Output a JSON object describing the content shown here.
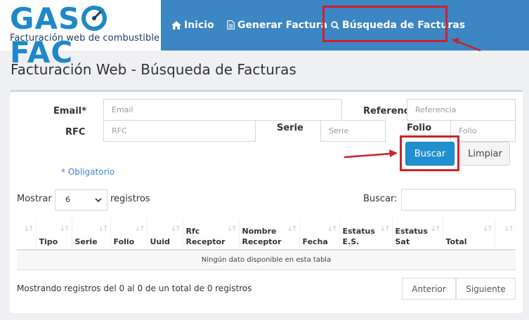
{
  "brand": {
    "logo_part1": "GAS",
    "logo_part2": "FAC",
    "tagline": "Facturación web de combustible"
  },
  "nav": {
    "items": [
      {
        "label": "Inicio",
        "icon": "home-icon"
      },
      {
        "label": "Generar Factura",
        "icon": "file-icon"
      },
      {
        "label": "Búsqueda de Facturas",
        "icon": "search-icon"
      }
    ],
    "active_index": 2
  },
  "page_title": "Facturación Web - Búsqueda de Facturas",
  "form": {
    "email_label": "Email*",
    "email_placeholder": "Email",
    "referencia_label": "Referencia",
    "referencia_placeholder": "Referencia",
    "rfc_label": "RFC",
    "rfc_placeholder": "RFC",
    "serie_label": "Serie",
    "serie_placeholder": "Serie",
    "folio_label": "Folio",
    "folio_placeholder": "Folio",
    "buscar_button": "Buscar",
    "limpiar_button": "Limpiar",
    "required_note": "* Obligatorio"
  },
  "table_controls": {
    "show_label": "Mostrar",
    "page_size": "6",
    "records_label": "registros",
    "search_label": "Buscar:"
  },
  "table": {
    "columns": [
      "",
      "Tipo",
      "Serie",
      "Folio",
      "Uuid",
      "Rfc Receptor",
      "Nombre Receptor",
      "Fecha",
      "Estatus E.S.",
      "Estatus Sat",
      "Total",
      ""
    ],
    "empty_message": "Ningún dato disponible en esta tabla"
  },
  "footer": {
    "info": "Mostrando registros del 0 al 0 de un total de 0 registros",
    "prev_button": "Anterior",
    "next_button": "Siguiente"
  },
  "colors": {
    "navbar": "#3b86c3",
    "primary_button": "#1f8fcf",
    "highlight": "#d0202a"
  }
}
